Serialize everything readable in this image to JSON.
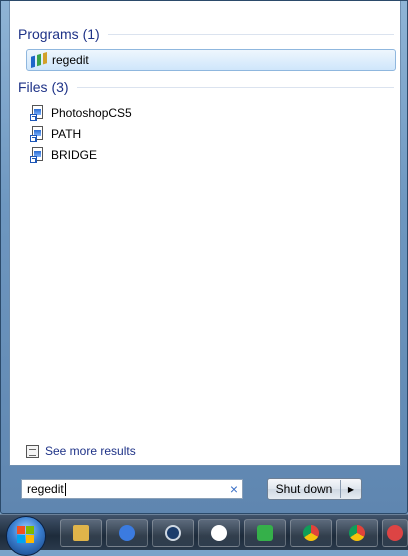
{
  "sections": {
    "programs": {
      "heading": "Programs (1)",
      "items": [
        {
          "label": "regedit",
          "icon": "registry-editor-icon",
          "selected": true
        }
      ]
    },
    "files": {
      "heading": "Files (3)",
      "items": [
        {
          "label": "PhotoshopCS5",
          "icon": "file-shortcut-icon"
        },
        {
          "label": "PATH",
          "icon": "file-shortcut-icon"
        },
        {
          "label": "BRIDGE",
          "icon": "file-shortcut-icon"
        }
      ]
    }
  },
  "see_more": {
    "label": "See more results",
    "icon": "see-more-results-icon"
  },
  "search": {
    "value": "regedit",
    "clear_glyph": "×"
  },
  "shutdown": {
    "label": "Shut down",
    "arrow_glyph": "▶"
  },
  "taskbar": {
    "start_icon": "windows-start-orb-icon",
    "apps": [
      {
        "name": "file-explorer-icon",
        "color": "#e0b44a"
      },
      {
        "name": "blue-circle-app-icon",
        "color": "#3b7be0"
      },
      {
        "name": "steam-icon",
        "color": "#1b3c6b"
      },
      {
        "name": "media-player-icon",
        "color": "#ffffff"
      },
      {
        "name": "green-app-icon",
        "color": "#35b04a"
      },
      {
        "name": "chrome-icon",
        "color": "#e0433b"
      },
      {
        "name": "chrome-icon-2",
        "color": "#e0433b"
      },
      {
        "name": "partial-app-icon",
        "color": "#d44"
      }
    ]
  }
}
